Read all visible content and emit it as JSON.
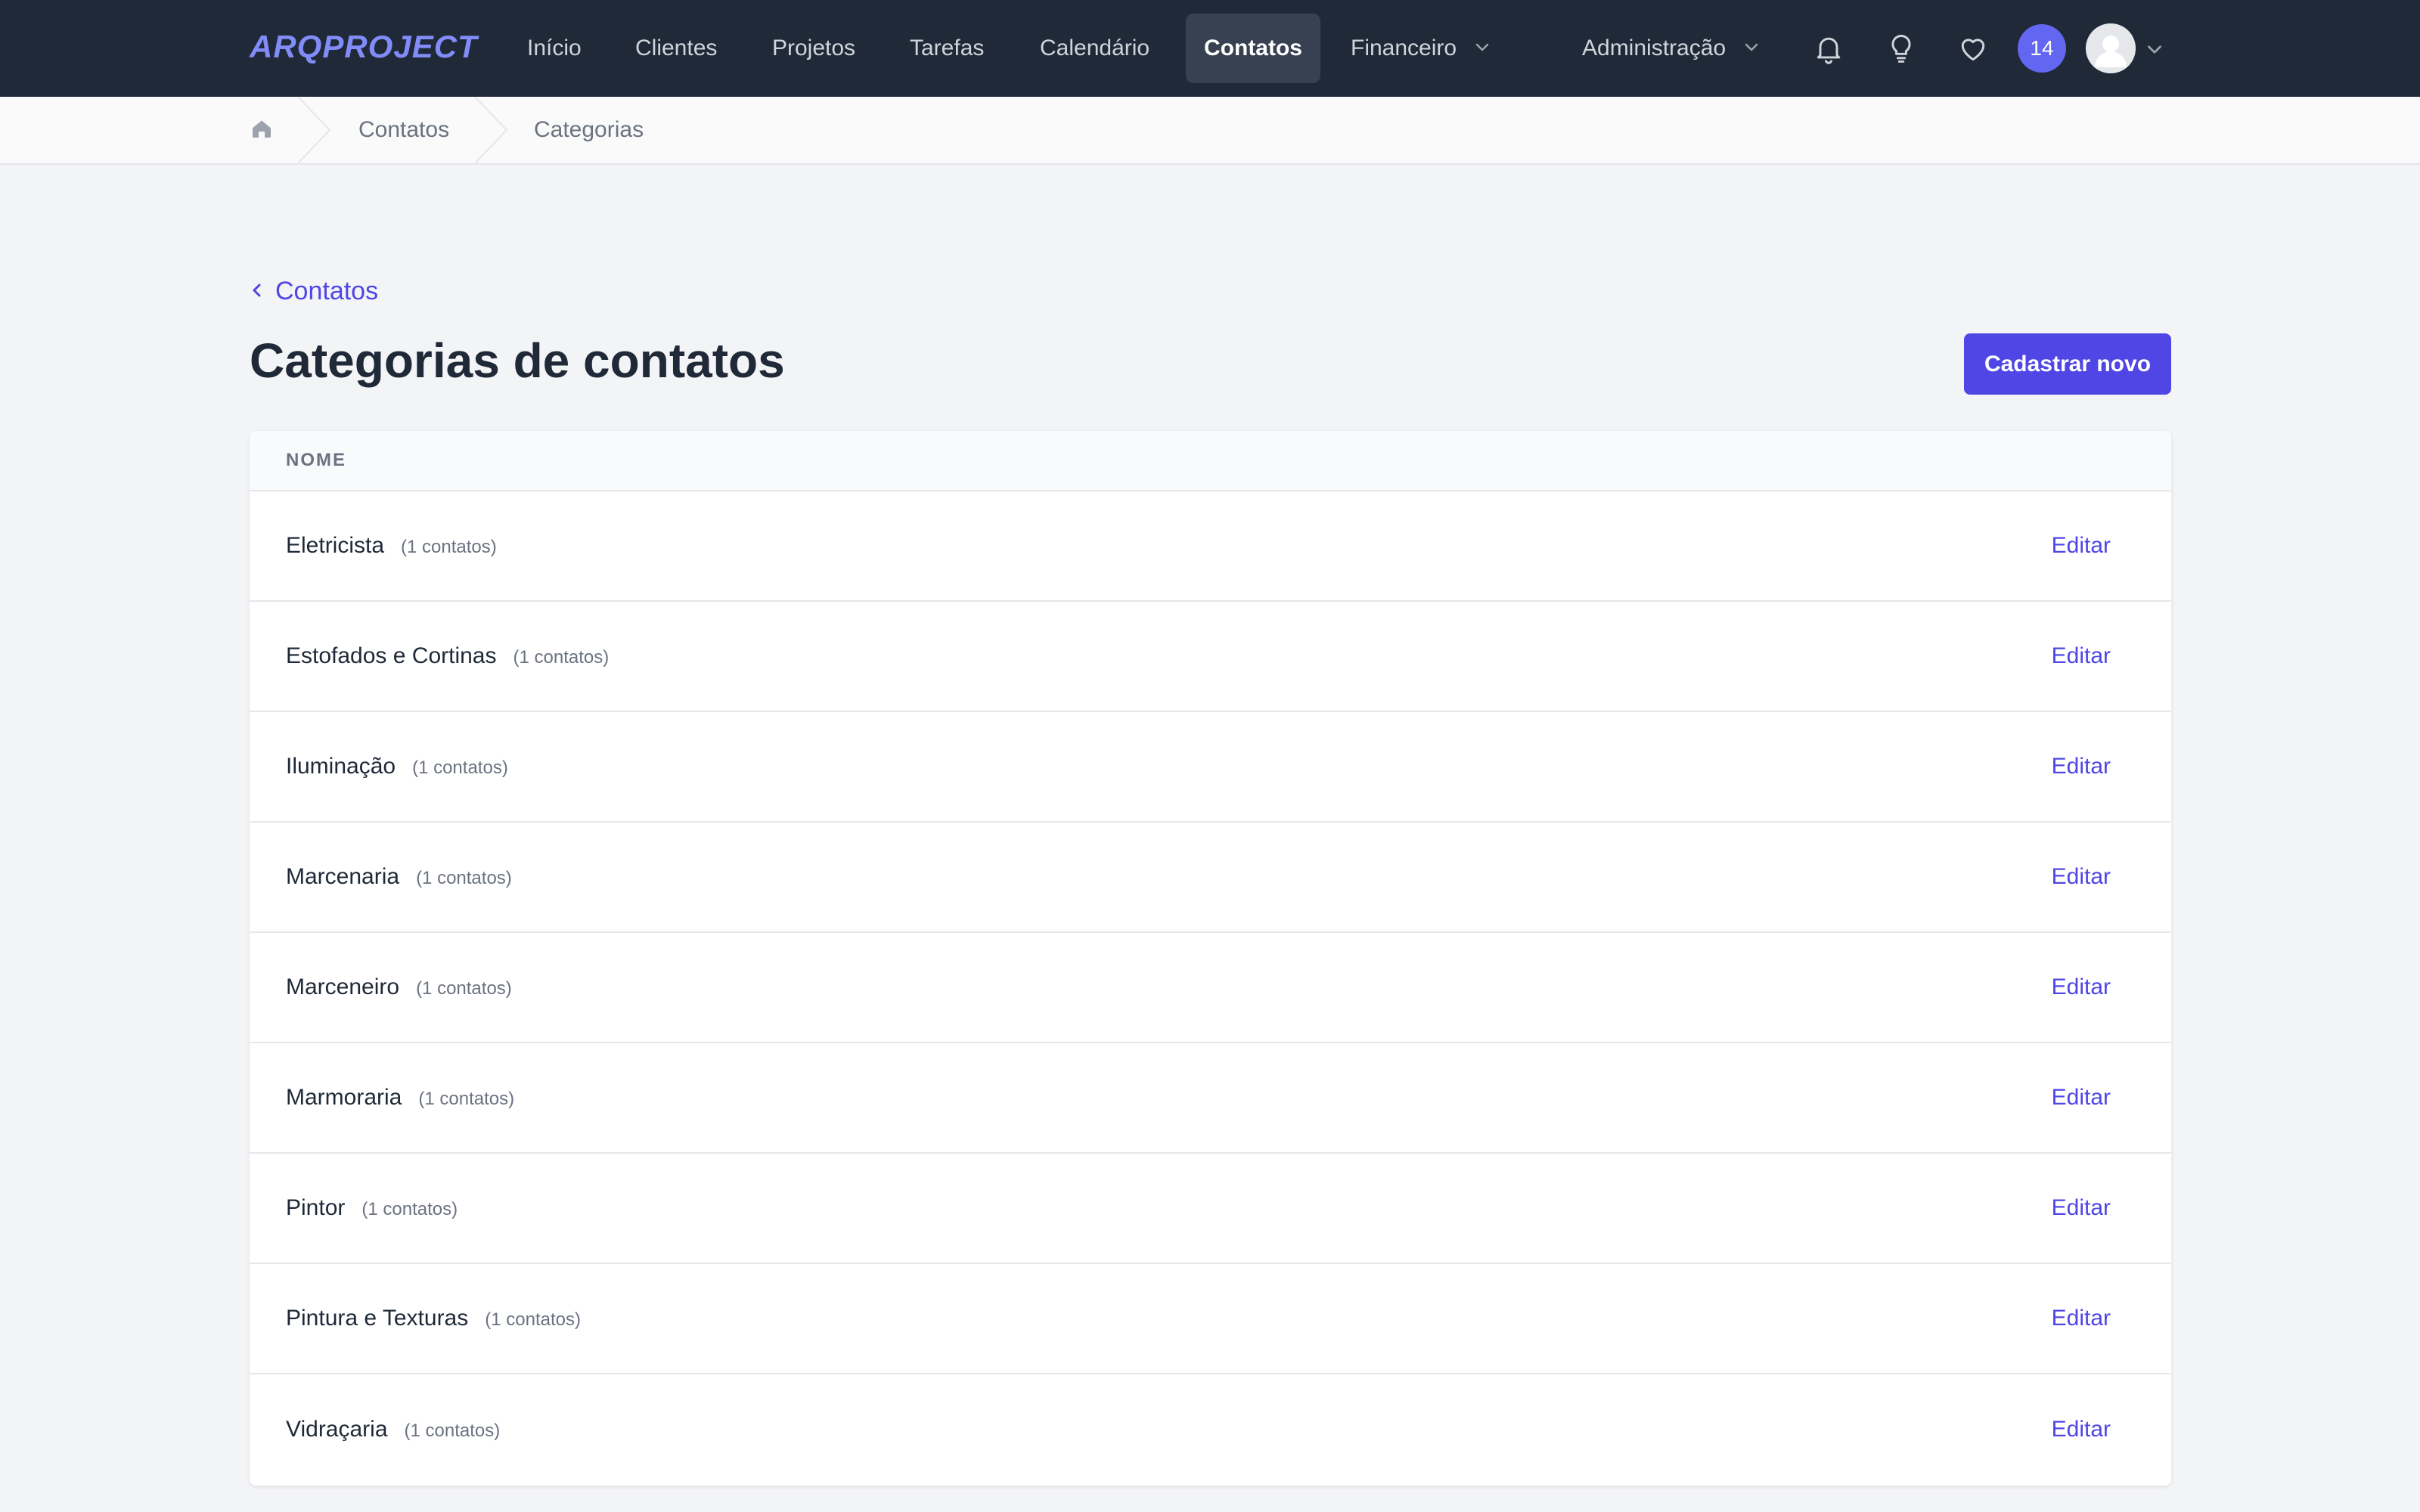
{
  "navbar": {
    "logo": "ARQPROJECT",
    "items": [
      {
        "label": "Início"
      },
      {
        "label": "Clientes"
      },
      {
        "label": "Projetos"
      },
      {
        "label": "Tarefas"
      },
      {
        "label": "Calendário"
      },
      {
        "label": "Contatos",
        "active": true
      },
      {
        "label": "Financeiro",
        "dropdown": true
      },
      {
        "label": "Administração",
        "dropdown": true
      }
    ],
    "icons": [
      "bell-icon",
      "lightbulb-icon",
      "heart-icon"
    ],
    "notification_count": "14"
  },
  "breadcrumb": {
    "items": [
      {
        "label": "Contatos"
      },
      {
        "label": "Categorias"
      }
    ]
  },
  "page": {
    "back_label": "Contatos",
    "title": "Categorias de contatos",
    "new_button": "Cadastrar novo"
  },
  "table": {
    "header": "NOME",
    "rows": [
      {
        "name": "Eletricista",
        "count": "(1 contatos)",
        "action": "Editar"
      },
      {
        "name": "Estofados e Cortinas",
        "count": "(1 contatos)",
        "action": "Editar"
      },
      {
        "name": "Iluminação",
        "count": "(1 contatos)",
        "action": "Editar"
      },
      {
        "name": "Marcenaria",
        "count": "(1 contatos)",
        "action": "Editar"
      },
      {
        "name": "Marceneiro",
        "count": "(1 contatos)",
        "action": "Editar"
      },
      {
        "name": "Marmoraria",
        "count": "(1 contatos)",
        "action": "Editar"
      },
      {
        "name": "Pintor",
        "count": "(1 contatos)",
        "action": "Editar"
      },
      {
        "name": "Pintura e Texturas",
        "count": "(1 contatos)",
        "action": "Editar"
      },
      {
        "name": "Vidraçaria",
        "count": "(1 contatos)",
        "action": "Editar"
      }
    ]
  },
  "colors": {
    "navbar_bg": "#1f2937",
    "accent": "#4f46e5",
    "badge": "#6366f1",
    "page_bg": "#f3f4f6"
  }
}
